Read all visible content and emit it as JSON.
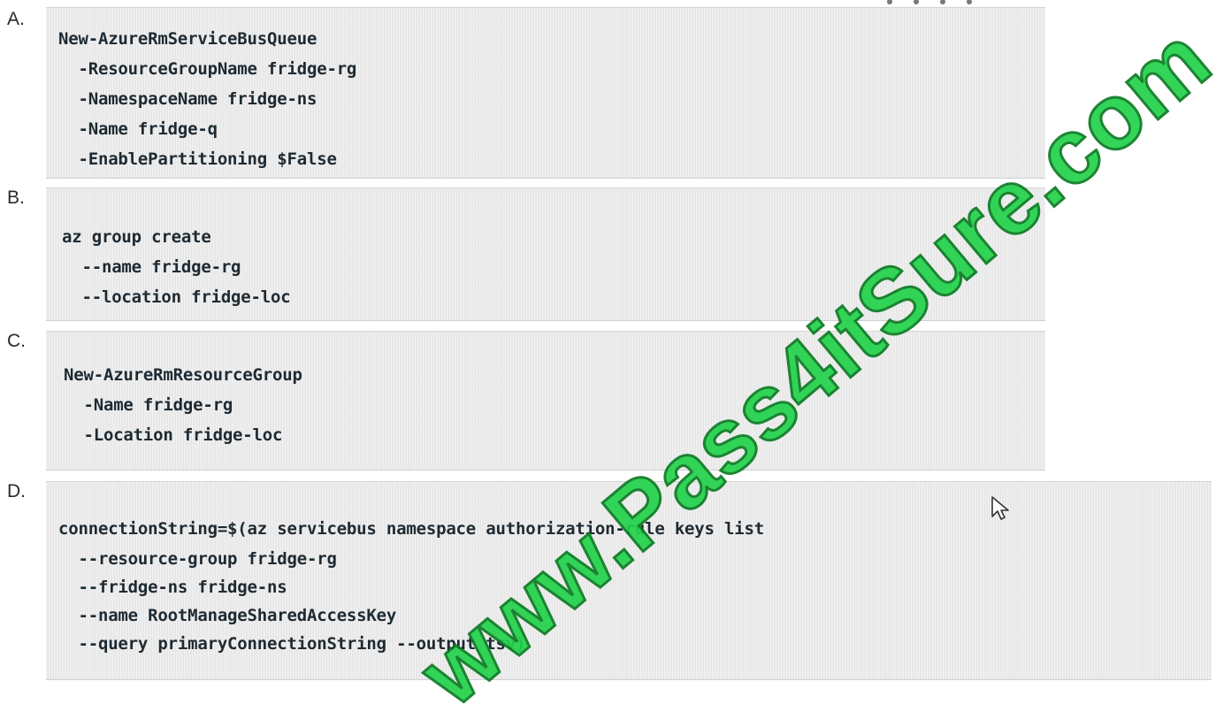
{
  "options": [
    {
      "letter": "A.",
      "lines": [
        "New-AzureRmServiceBusQueue",
        "  -ResourceGroupName fridge-rg",
        "  -NamespaceName fridge-ns",
        "  -Name fridge-q",
        "  -EnablePartitioning $False"
      ]
    },
    {
      "letter": "B.",
      "lines": [
        "az group create",
        "  --name fridge-rg",
        "  --location fridge-loc"
      ]
    },
    {
      "letter": "C.",
      "lines": [
        "New-AzureRmResourceGroup",
        "  -Name fridge-rg",
        "  -Location fridge-loc"
      ]
    },
    {
      "letter": "D.",
      "lines": [
        "connectionString=$(az servicebus namespace authorization-rule keys list",
        "  --resource-group fridge-rg",
        "  --fridge-ns fridge-ns",
        "  --name RootManageSharedAccessKey",
        "  --query primaryConnectionString --output tsv)"
      ]
    }
  ],
  "watermark": {
    "text": "www.Pass4itSure.com",
    "color": "#22d24a"
  },
  "icons": {
    "cursor": "mouse-pointer-icon"
  }
}
